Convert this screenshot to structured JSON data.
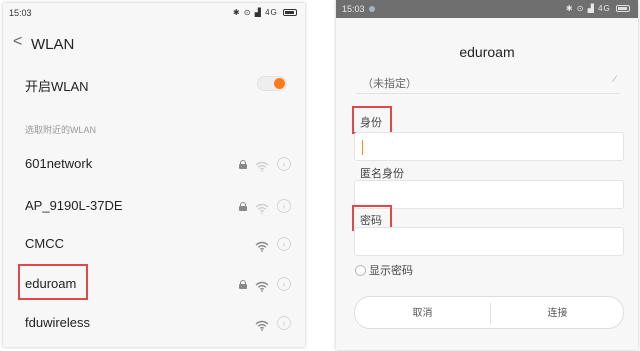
{
  "left": {
    "status": {
      "time": "15:03",
      "network": "4G"
    },
    "header": {
      "back_glyph": "<",
      "title": "WLAN"
    },
    "toggle_label": "开启WLAN",
    "toggle_on": true,
    "section_label": "选取附近的WLAN",
    "networks": [
      {
        "name": "601network",
        "locked": true,
        "signal": "weak"
      },
      {
        "name": "AP_9190L-37DE",
        "locked": true,
        "signal": "weak"
      },
      {
        "name": "CMCC",
        "locked": false,
        "signal": "strong"
      },
      {
        "name": "eduroam",
        "locked": true,
        "signal": "strong",
        "highlighted": true
      },
      {
        "name": "fduwireless",
        "locked": false,
        "signal": "strong"
      }
    ]
  },
  "right": {
    "status": {
      "time": "15:03",
      "network": "4G"
    },
    "title": "eduroam",
    "unspecified_value": "（未指定）",
    "identity_label": "身份",
    "identity_value": "",
    "anonymous_label": "匿名身份",
    "anonymous_value": "",
    "password_label": "密码",
    "password_value": "",
    "show_password_label": "显示密码",
    "cancel_label": "取消",
    "connect_label": "连接"
  },
  "colors": {
    "accent": "#ff7a1a",
    "highlight_box": "#e0484a",
    "status_bar_dark": "#6f6f6f"
  }
}
